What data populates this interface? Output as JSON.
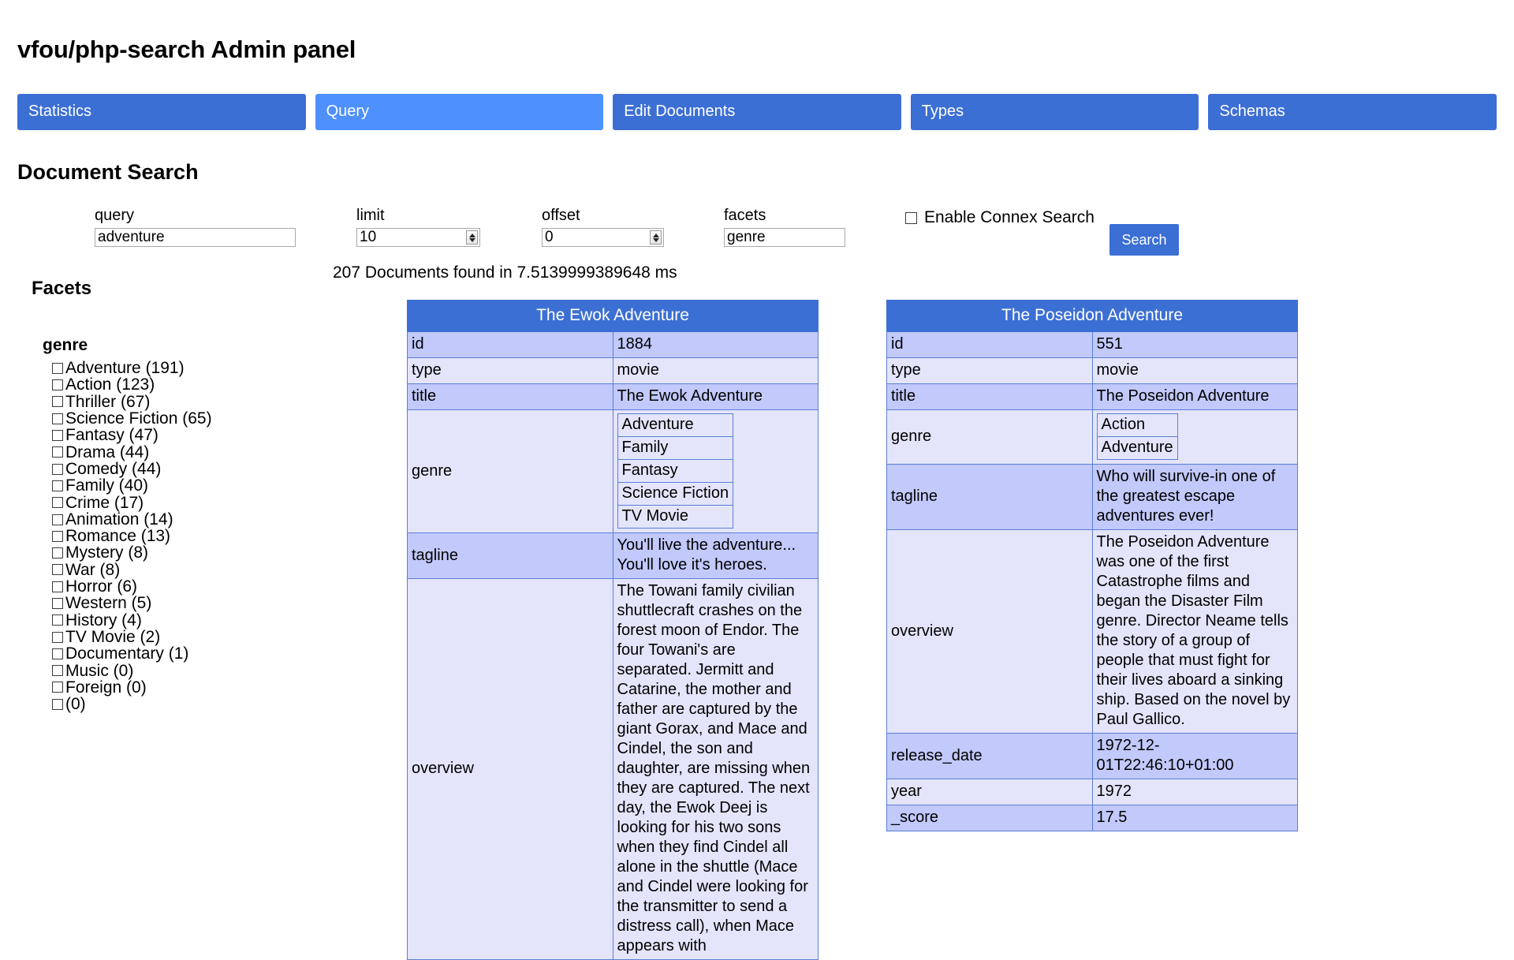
{
  "app": {
    "title": "vfou/php-search Admin panel"
  },
  "tabs": [
    {
      "label": "Statistics",
      "active": false
    },
    {
      "label": "Query",
      "active": true
    },
    {
      "label": "Edit Documents",
      "active": false
    },
    {
      "label": "Types",
      "active": false
    },
    {
      "label": "Schemas",
      "active": false
    }
  ],
  "section": {
    "title": "Document Search"
  },
  "form": {
    "query": {
      "label": "query",
      "value": "adventure"
    },
    "limit": {
      "label": "limit",
      "value": "10"
    },
    "offset": {
      "label": "offset",
      "value": "0"
    },
    "facets": {
      "label": "facets",
      "value": "genre"
    },
    "connex": {
      "label": "Enable Connex Search",
      "checked": false
    },
    "search_button": "Search"
  },
  "results": {
    "summary": "207 Documents found in 7.5139999389648 ms",
    "count": 207,
    "time_ms": "7.5139999389648"
  },
  "facets_panel": {
    "title": "Facets",
    "groups": [
      {
        "name": "genre",
        "items": [
          {
            "label": "Adventure (191)",
            "checked": false
          },
          {
            "label": "Action (123)",
            "checked": false
          },
          {
            "label": "Thriller (67)",
            "checked": false
          },
          {
            "label": "Science Fiction (65)",
            "checked": false
          },
          {
            "label": "Fantasy (47)",
            "checked": false
          },
          {
            "label": "Drama (44)",
            "checked": false
          },
          {
            "label": "Comedy (44)",
            "checked": false
          },
          {
            "label": "Family (40)",
            "checked": false
          },
          {
            "label": "Crime (17)",
            "checked": false
          },
          {
            "label": "Animation (14)",
            "checked": false
          },
          {
            "label": "Romance (13)",
            "checked": false
          },
          {
            "label": "Mystery (8)",
            "checked": false
          },
          {
            "label": "War (8)",
            "checked": false
          },
          {
            "label": "Horror (6)",
            "checked": false
          },
          {
            "label": "Western (5)",
            "checked": false
          },
          {
            "label": "History (4)",
            "checked": false
          },
          {
            "label": "TV Movie (2)",
            "checked": false
          },
          {
            "label": "Documentary (1)",
            "checked": false
          },
          {
            "label": "Music (0)",
            "checked": false
          },
          {
            "label": "Foreign (0)",
            "checked": false
          },
          {
            "label": " (0)",
            "checked": false
          }
        ]
      }
    ]
  },
  "documents": [
    {
      "heading": "The Ewok Adventure",
      "rows": [
        {
          "key": "id",
          "value": "1884"
        },
        {
          "key": "type",
          "value": "movie"
        },
        {
          "key": "title",
          "value": "The Ewok Adventure"
        },
        {
          "key": "genre",
          "list": [
            "Adventure",
            "Family",
            "Fantasy",
            "Science Fiction",
            "TV Movie"
          ]
        },
        {
          "key": "tagline",
          "value": "You'll live the adventure... You'll love it's heroes."
        },
        {
          "key": "overview",
          "value": "The Towani family civilian shuttlecraft crashes on the forest moon of Endor. The four Towani's are separated. Jermitt and Catarine, the mother and father are captured by the giant Gorax, and Mace and Cindel, the son and daughter, are missing when they are captured. The next day, the Ewok Deej is looking for his two sons when they find Cindel all alone in the shuttle (Mace and Cindel were looking for the transmitter to send a distress call), when Mace appears with"
        }
      ]
    },
    {
      "heading": "The Poseidon Adventure",
      "rows": [
        {
          "key": "id",
          "value": "551"
        },
        {
          "key": "type",
          "value": "movie"
        },
        {
          "key": "title",
          "value": "The Poseidon Adventure"
        },
        {
          "key": "genre",
          "list": [
            "Action",
            "Adventure"
          ]
        },
        {
          "key": "tagline",
          "value": "Who will survive-in one of the greatest escape adventures ever!"
        },
        {
          "key": "overview",
          "value": "The Poseidon Adventure was one of the first Catastrophe films and began the Disaster Film genre. Director Neame tells the story of a group of people that must fight for their lives aboard a sinking ship. Based on the novel by Paul Gallico."
        },
        {
          "key": "release_date",
          "value": "1972-12-01T22:46:10+01:00"
        },
        {
          "key": "year",
          "value": "1972"
        },
        {
          "key": "_score",
          "value": "17.5"
        }
      ]
    }
  ],
  "colors": {
    "tab": "#3c6fd4",
    "tab_active": "#4d90fe",
    "card_header": "#3c6fd4",
    "row_light": "#e4e5fb",
    "row_dark": "#c2c9fb",
    "border": "#5b7fd4"
  }
}
